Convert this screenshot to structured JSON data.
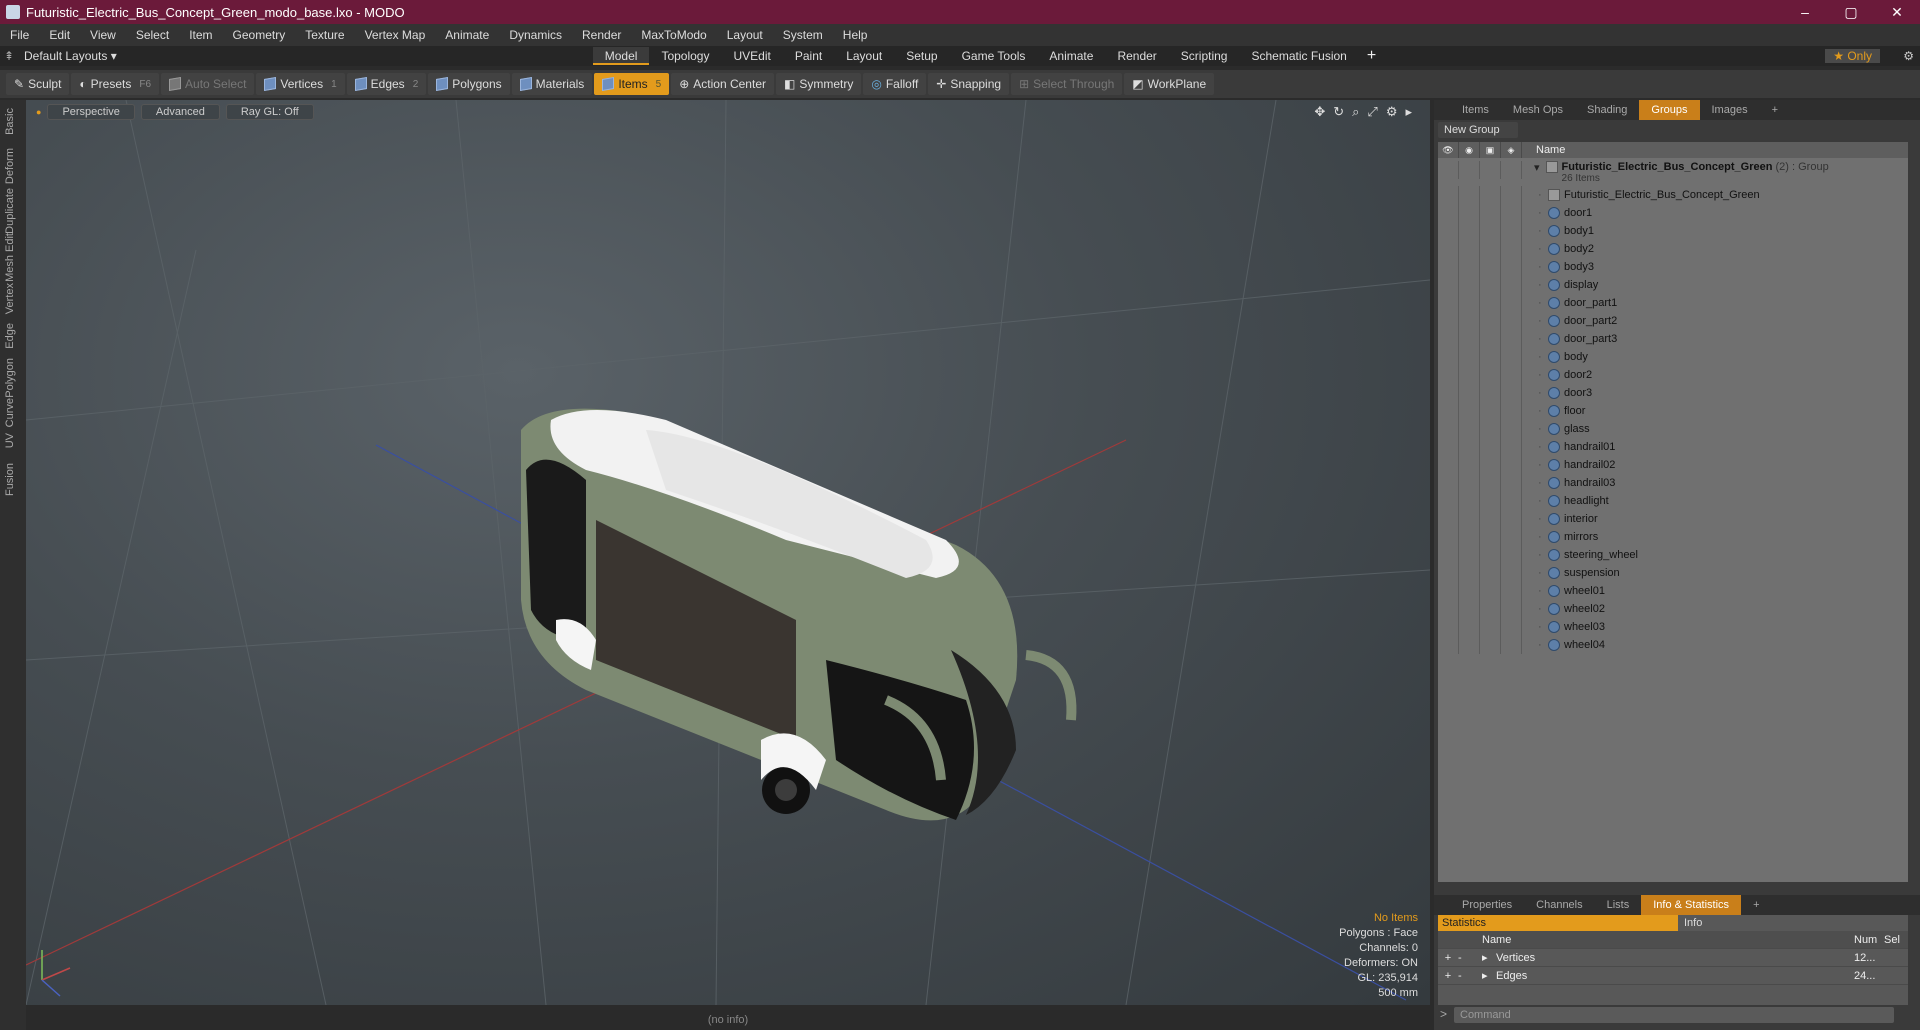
{
  "window": {
    "title": "Futuristic_Electric_Bus_Concept_Green_modo_base.lxo - MODO",
    "minimize": "–",
    "maximize": "▢",
    "close": "✕"
  },
  "menu": [
    "File",
    "Edit",
    "View",
    "Select",
    "Item",
    "Geometry",
    "Texture",
    "Vertex Map",
    "Animate",
    "Dynamics",
    "Render",
    "MaxToModo",
    "Layout",
    "System",
    "Help"
  ],
  "layout": {
    "preset": "Default Layouts ▾",
    "tabs": [
      "Model",
      "Topology",
      "UVEdit",
      "Paint",
      "Layout",
      "Setup",
      "Game Tools",
      "Animate",
      "Render",
      "Scripting",
      "Schematic Fusion"
    ],
    "active": "Model",
    "plus": "+",
    "only": "★ Only"
  },
  "toolbar": {
    "sculpt": "Sculpt",
    "presets": "Presets",
    "presets_key": "F6",
    "auto_select": "Auto Select",
    "vertices": "Vertices",
    "vertices_key": "1",
    "edges": "Edges",
    "edges_key": "2",
    "polygons": "Polygons",
    "materials": "Materials",
    "items": "Items",
    "items_key": "5",
    "action_center": "Action Center",
    "symmetry": "Symmetry",
    "falloff": "Falloff",
    "snapping": "Snapping",
    "select_through": "Select Through",
    "workplane": "WorkPlane"
  },
  "left_tabs": [
    "Basic",
    "Deform",
    "Duplicate",
    "Mesh Edit",
    "Vertex",
    "Edge",
    "Polygon",
    "Curve",
    "UV",
    "Fusion"
  ],
  "viewport": {
    "perspective": "Perspective",
    "advanced": "Advanced",
    "raygl": "Ray GL: Off",
    "stats": {
      "no_items": "No Items",
      "polygons": "Polygons : Face",
      "channels": "Channels: 0",
      "deformers": "Deformers: ON",
      "gl": "GL: 235,914",
      "scale": "500 mm"
    }
  },
  "status": "(no info)",
  "groups_panel": {
    "tabs": [
      "Items",
      "Mesh Ops",
      "Shading",
      "Groups",
      "Images"
    ],
    "active": "Groups",
    "plus": "+",
    "new_group": "New Group",
    "name_col": "Name",
    "group_name": "Futuristic_Electric_Bus_Concept_Green",
    "group_suffix": "(2) : Group",
    "group_count": "26 Items",
    "items": [
      "Futuristic_Electric_Bus_Concept_Green",
      "door1",
      "body1",
      "body2",
      "body3",
      "display",
      "door_part1",
      "door_part2",
      "door_part3",
      "body",
      "door2",
      "door3",
      "floor",
      "glass",
      "handrail01",
      "handrail02",
      "handrail03",
      "headlight",
      "interior",
      "mirrors",
      "steering_wheel",
      "suspension",
      "wheel01",
      "wheel02",
      "wheel03",
      "wheel04"
    ]
  },
  "bottom_panel": {
    "tabs": [
      "Properties",
      "Channels",
      "Lists",
      "Info & Statistics"
    ],
    "active": "Info & Statistics",
    "plus": "+",
    "statistics": "Statistics",
    "info": "Info",
    "head": {
      "name": "Name",
      "num": "Num",
      "sel": "Sel"
    },
    "rows": [
      {
        "name": "Vertices",
        "num": "12..."
      },
      {
        "name": "Edges",
        "num": "24..."
      }
    ],
    "command_placeholder": "Command"
  }
}
